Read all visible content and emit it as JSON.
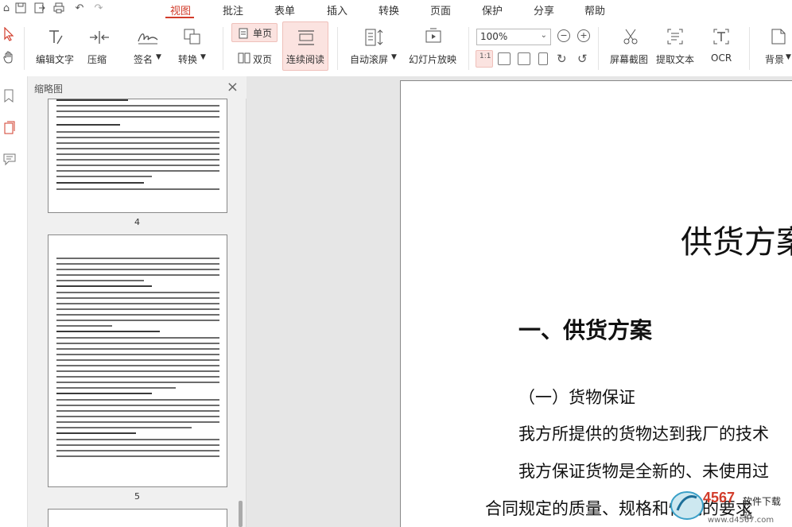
{
  "menu": {
    "tabs": [
      "视图",
      "批注",
      "表单",
      "插入",
      "转换",
      "页面",
      "保护",
      "分享",
      "帮助"
    ],
    "active": "视图"
  },
  "ribbon": {
    "edit_text": "编辑文字",
    "compress": "压缩",
    "sign": "签名",
    "convert": "转换",
    "single_page": "单页",
    "double_page": "双页",
    "continuous_read": "连续阅读",
    "auto_scroll": "自动滚屏",
    "slideshow": "幻灯片放映",
    "zoom_value": "100%",
    "screenshot": "屏幕截图",
    "extract_text": "提取文本",
    "ocr": "OCR",
    "background": "背景"
  },
  "thumbnails": {
    "title": "缩略图",
    "pages": [
      {
        "number": "4"
      },
      {
        "number": "5"
      }
    ]
  },
  "document": {
    "title": "供货方案",
    "heading1": "一、供货方案",
    "heading2": "（一）货物保证",
    "para1": "我方所提供的货物达到我厂的技术",
    "para2": "我方保证货物是全新的、未使用过",
    "para3": "合同规定的质量、规格和性能的要求"
  },
  "watermark": {
    "brand": "4567",
    "sub": "软件下载站",
    "url": "www.d4567.com"
  },
  "colors": {
    "accent": "#d23c2b",
    "active_bg": "#fbe3e0",
    "panel_bg": "#f0f0f0",
    "canvas_bg": "#e6e6e6"
  }
}
